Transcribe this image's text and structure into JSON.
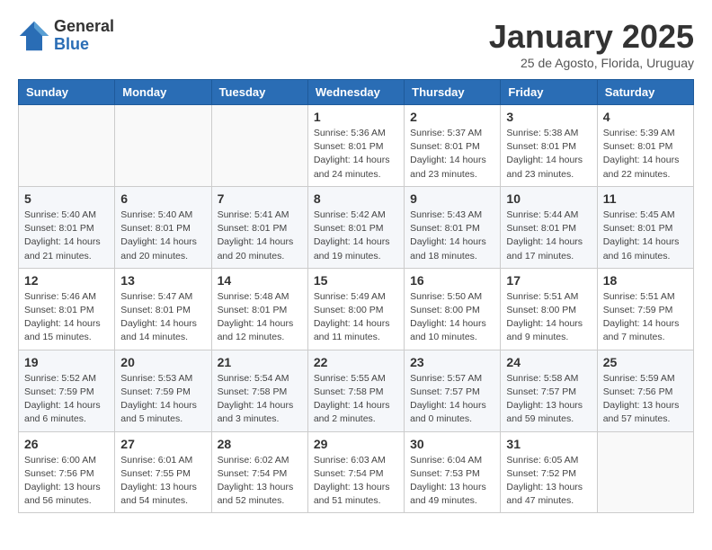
{
  "logo": {
    "general": "General",
    "blue": "Blue"
  },
  "title": "January 2025",
  "subtitle": "25 de Agosto, Florida, Uruguay",
  "headers": [
    "Sunday",
    "Monday",
    "Tuesday",
    "Wednesday",
    "Thursday",
    "Friday",
    "Saturday"
  ],
  "weeks": [
    [
      {
        "day": "",
        "info": ""
      },
      {
        "day": "",
        "info": ""
      },
      {
        "day": "",
        "info": ""
      },
      {
        "day": "1",
        "info": "Sunrise: 5:36 AM\nSunset: 8:01 PM\nDaylight: 14 hours and 24 minutes."
      },
      {
        "day": "2",
        "info": "Sunrise: 5:37 AM\nSunset: 8:01 PM\nDaylight: 14 hours and 23 minutes."
      },
      {
        "day": "3",
        "info": "Sunrise: 5:38 AM\nSunset: 8:01 PM\nDaylight: 14 hours and 23 minutes."
      },
      {
        "day": "4",
        "info": "Sunrise: 5:39 AM\nSunset: 8:01 PM\nDaylight: 14 hours and 22 minutes."
      }
    ],
    [
      {
        "day": "5",
        "info": "Sunrise: 5:40 AM\nSunset: 8:01 PM\nDaylight: 14 hours and 21 minutes."
      },
      {
        "day": "6",
        "info": "Sunrise: 5:40 AM\nSunset: 8:01 PM\nDaylight: 14 hours and 20 minutes."
      },
      {
        "day": "7",
        "info": "Sunrise: 5:41 AM\nSunset: 8:01 PM\nDaylight: 14 hours and 20 minutes."
      },
      {
        "day": "8",
        "info": "Sunrise: 5:42 AM\nSunset: 8:01 PM\nDaylight: 14 hours and 19 minutes."
      },
      {
        "day": "9",
        "info": "Sunrise: 5:43 AM\nSunset: 8:01 PM\nDaylight: 14 hours and 18 minutes."
      },
      {
        "day": "10",
        "info": "Sunrise: 5:44 AM\nSunset: 8:01 PM\nDaylight: 14 hours and 17 minutes."
      },
      {
        "day": "11",
        "info": "Sunrise: 5:45 AM\nSunset: 8:01 PM\nDaylight: 14 hours and 16 minutes."
      }
    ],
    [
      {
        "day": "12",
        "info": "Sunrise: 5:46 AM\nSunset: 8:01 PM\nDaylight: 14 hours and 15 minutes."
      },
      {
        "day": "13",
        "info": "Sunrise: 5:47 AM\nSunset: 8:01 PM\nDaylight: 14 hours and 14 minutes."
      },
      {
        "day": "14",
        "info": "Sunrise: 5:48 AM\nSunset: 8:01 PM\nDaylight: 14 hours and 12 minutes."
      },
      {
        "day": "15",
        "info": "Sunrise: 5:49 AM\nSunset: 8:00 PM\nDaylight: 14 hours and 11 minutes."
      },
      {
        "day": "16",
        "info": "Sunrise: 5:50 AM\nSunset: 8:00 PM\nDaylight: 14 hours and 10 minutes."
      },
      {
        "day": "17",
        "info": "Sunrise: 5:51 AM\nSunset: 8:00 PM\nDaylight: 14 hours and 9 minutes."
      },
      {
        "day": "18",
        "info": "Sunrise: 5:51 AM\nSunset: 7:59 PM\nDaylight: 14 hours and 7 minutes."
      }
    ],
    [
      {
        "day": "19",
        "info": "Sunrise: 5:52 AM\nSunset: 7:59 PM\nDaylight: 14 hours and 6 minutes."
      },
      {
        "day": "20",
        "info": "Sunrise: 5:53 AM\nSunset: 7:59 PM\nDaylight: 14 hours and 5 minutes."
      },
      {
        "day": "21",
        "info": "Sunrise: 5:54 AM\nSunset: 7:58 PM\nDaylight: 14 hours and 3 minutes."
      },
      {
        "day": "22",
        "info": "Sunrise: 5:55 AM\nSunset: 7:58 PM\nDaylight: 14 hours and 2 minutes."
      },
      {
        "day": "23",
        "info": "Sunrise: 5:57 AM\nSunset: 7:57 PM\nDaylight: 14 hours and 0 minutes."
      },
      {
        "day": "24",
        "info": "Sunrise: 5:58 AM\nSunset: 7:57 PM\nDaylight: 13 hours and 59 minutes."
      },
      {
        "day": "25",
        "info": "Sunrise: 5:59 AM\nSunset: 7:56 PM\nDaylight: 13 hours and 57 minutes."
      }
    ],
    [
      {
        "day": "26",
        "info": "Sunrise: 6:00 AM\nSunset: 7:56 PM\nDaylight: 13 hours and 56 minutes."
      },
      {
        "day": "27",
        "info": "Sunrise: 6:01 AM\nSunset: 7:55 PM\nDaylight: 13 hours and 54 minutes."
      },
      {
        "day": "28",
        "info": "Sunrise: 6:02 AM\nSunset: 7:54 PM\nDaylight: 13 hours and 52 minutes."
      },
      {
        "day": "29",
        "info": "Sunrise: 6:03 AM\nSunset: 7:54 PM\nDaylight: 13 hours and 51 minutes."
      },
      {
        "day": "30",
        "info": "Sunrise: 6:04 AM\nSunset: 7:53 PM\nDaylight: 13 hours and 49 minutes."
      },
      {
        "day": "31",
        "info": "Sunrise: 6:05 AM\nSunset: 7:52 PM\nDaylight: 13 hours and 47 minutes."
      },
      {
        "day": "",
        "info": ""
      }
    ]
  ]
}
